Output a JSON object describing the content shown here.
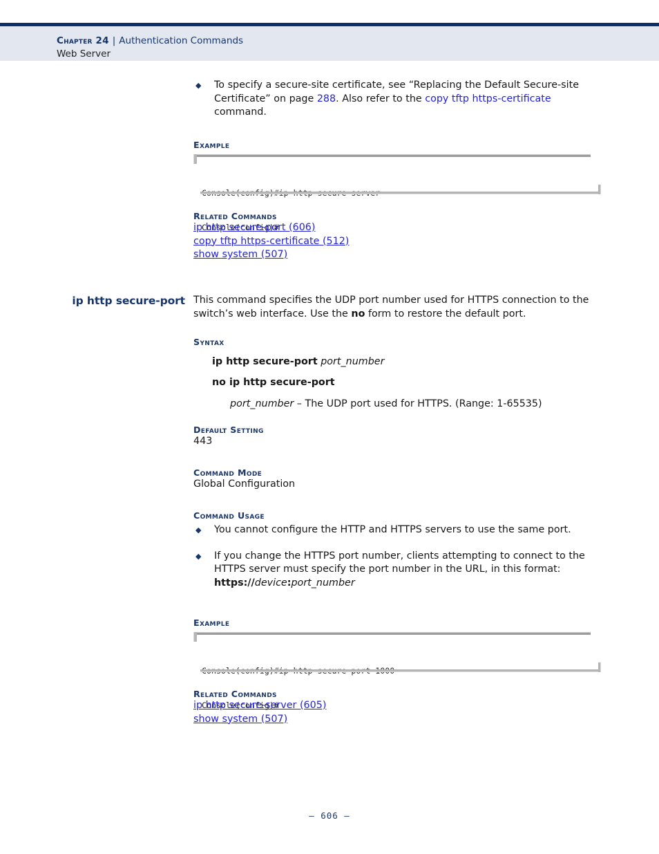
{
  "header": {
    "chapter_label": "Chapter 24",
    "separator": "|",
    "chapter_title": "Authentication Commands",
    "section_title": "Web Server"
  },
  "top_bullet": {
    "marker": "◆",
    "text_part1": "To specify a secure-site certificate, see “Replacing the Default Secure-site Certificate” on page ",
    "page_link": "288",
    "text_part2": ". Also refer to the ",
    "cmd_link": "copy tftp https-certificate",
    "text_part3": " command."
  },
  "example1": {
    "heading": "Example",
    "line1": "Console(config)#ip http secure-server",
    "line2": "Console(config)#"
  },
  "related1": {
    "heading": "Related Commands",
    "links": [
      "ip http secure-port (606)",
      "copy tftp https-certificate (512)",
      "show system (507)"
    ]
  },
  "command": {
    "name": "ip http secure-port",
    "description_part1": "This command specifies the UDP port number used for HTTPS connection to the switch’s web interface. Use the ",
    "description_bold": "no",
    "description_part2": " form to restore the default port."
  },
  "syntax": {
    "heading": "Syntax",
    "form1_bold": "ip http secure-port",
    "form1_italic": "port_number",
    "form2_bold": "no ip http secure-port",
    "arg_italic": "port_number",
    "arg_text": " – The UDP port used for HTTPS. (Range: 1-65535)"
  },
  "default_setting": {
    "heading": "Default Setting",
    "value": "443"
  },
  "command_mode": {
    "heading": "Command Mode",
    "value": "Global Configuration"
  },
  "command_usage": {
    "heading": "Command Usage",
    "marker": "◆",
    "bullets": [
      {
        "text": "You cannot configure the HTTP and HTTPS servers to use the same port."
      },
      {
        "text_part1": "If you change the HTTPS port number, clients attempting to connect to the HTTPS server must specify the port number in the URL, in this format: ",
        "bold_part": "https://",
        "italic_part": "device",
        "bold_part2": ":",
        "italic_part2": "port_number"
      }
    ]
  },
  "example2": {
    "heading": "Example",
    "line1": "Console(config)#ip http secure-port 1000",
    "line2": "Console(config)#"
  },
  "related2": {
    "heading": "Related Commands",
    "links": [
      "ip http secure-server (605)",
      "show system (507)"
    ]
  },
  "footer": {
    "page_number": "–  606  –"
  }
}
